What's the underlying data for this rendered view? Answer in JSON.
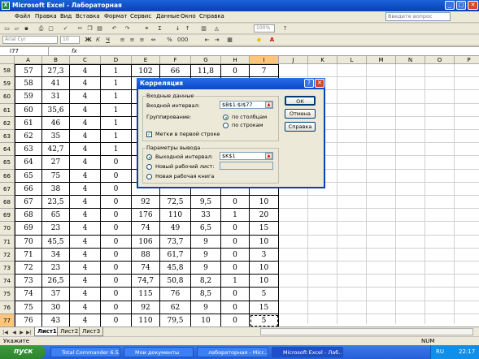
{
  "window": {
    "title": "Microsoft Excel - Лабораторная",
    "app_icon": "X"
  },
  "menu": [
    "Файл",
    "Правка",
    "Вид",
    "Вставка",
    "Формат",
    "Сервис",
    "Данные",
    "Окно",
    "Справка"
  ],
  "help_box": {
    "placeholder": "Введите вопрос"
  },
  "format_toolbar": {
    "font": "Arial Cyr",
    "size": "10",
    "zoom": "100%"
  },
  "formula_bar": {
    "cell": "I77",
    "fx": "fx"
  },
  "columns": [
    "A",
    "B",
    "C",
    "D",
    "E",
    "F",
    "G",
    "H",
    "I",
    "J",
    "K",
    "L",
    "M",
    "N",
    "O",
    "P"
  ],
  "rows": [
    {
      "n": "58",
      "v": [
        "57",
        "27,3",
        "4",
        "1",
        "102",
        "66",
        "11,8",
        "0",
        "7"
      ]
    },
    {
      "n": "59",
      "v": [
        "58",
        "41",
        "4",
        "1",
        "",
        "",
        "",
        "",
        ""
      ]
    },
    {
      "n": "60",
      "v": [
        "59",
        "31",
        "4",
        "1",
        "",
        "",
        "",
        "",
        ""
      ]
    },
    {
      "n": "61",
      "v": [
        "60",
        "35,6",
        "4",
        "1",
        "",
        "",
        "",
        "",
        ""
      ]
    },
    {
      "n": "62",
      "v": [
        "61",
        "46",
        "4",
        "1",
        "",
        "",
        "",
        "",
        ""
      ]
    },
    {
      "n": "63",
      "v": [
        "62",
        "35",
        "4",
        "1",
        "",
        "",
        "",
        "",
        ""
      ]
    },
    {
      "n": "64",
      "v": [
        "63",
        "42,7",
        "4",
        "1",
        "",
        "",
        "",
        "",
        ""
      ]
    },
    {
      "n": "65",
      "v": [
        "64",
        "27",
        "4",
        "0",
        "",
        "",
        "",
        "",
        ""
      ]
    },
    {
      "n": "66",
      "v": [
        "65",
        "75",
        "4",
        "0",
        "",
        "",
        "",
        "",
        ""
      ]
    },
    {
      "n": "67",
      "v": [
        "66",
        "38",
        "4",
        "0",
        "",
        "",
        "",
        "",
        ""
      ]
    },
    {
      "n": "68",
      "v": [
        "67",
        "23,5",
        "4",
        "0",
        "92",
        "72,5",
        "9,5",
        "0",
        "10"
      ]
    },
    {
      "n": "69",
      "v": [
        "68",
        "65",
        "4",
        "0",
        "176",
        "110",
        "33",
        "1",
        "20"
      ]
    },
    {
      "n": "70",
      "v": [
        "69",
        "23",
        "4",
        "0",
        "74",
        "49",
        "6,5",
        "0",
        "15"
      ]
    },
    {
      "n": "71",
      "v": [
        "70",
        "45,5",
        "4",
        "0",
        "106",
        "73,7",
        "9",
        "0",
        "10"
      ]
    },
    {
      "n": "72",
      "v": [
        "71",
        "34",
        "4",
        "0",
        "88",
        "61,7",
        "9",
        "0",
        "3"
      ]
    },
    {
      "n": "73",
      "v": [
        "72",
        "23",
        "4",
        "0",
        "74",
        "45,8",
        "9",
        "0",
        "10"
      ]
    },
    {
      "n": "74",
      "v": [
        "73",
        "26,5",
        "4",
        "0",
        "74,7",
        "50,8",
        "8,2",
        "1",
        "10"
      ]
    },
    {
      "n": "75",
      "v": [
        "74",
        "37",
        "4",
        "0",
        "115",
        "76",
        "8,5",
        "0",
        "5"
      ]
    },
    {
      "n": "76",
      "v": [
        "75",
        "30",
        "4",
        "0",
        "92",
        "62",
        "9",
        "0",
        "15"
      ]
    },
    {
      "n": "77",
      "v": [
        "76",
        "43",
        "4",
        "0",
        "110",
        "79,5",
        "10",
        "0",
        "5"
      ]
    }
  ],
  "sheet_tabs": [
    "Лист1",
    "Лист2",
    "Лист3"
  ],
  "status": {
    "left": "Укажите",
    "right": "NUM"
  },
  "taskbar": {
    "start": "пуск",
    "tasks": [
      "Total Commander 6.5...",
      "Мои документы",
      "лабораторная - Micr...",
      "Microsoft Excel - Лаб..."
    ],
    "lang": "RU",
    "clock": "22:17"
  },
  "dialog": {
    "title": "Корреляция",
    "input_group": "Входные данные",
    "input_range_label": "Входной интервал:",
    "input_range_value": "$B$1:$I$77",
    "grouping_label": "Группирование:",
    "by_columns": "по столбцам",
    "by_rows": "по строкам",
    "labels_first_row": "Метки в первой строке",
    "output_group": "Параметры вывода",
    "output_range_label": "Выходной интервал:",
    "output_range_value": "$K$1",
    "new_sheet": "Новый рабочий лист:",
    "new_book": "Новая рабочая книга",
    "ok": "ОК",
    "cancel": "Отмена",
    "help": "Справка"
  }
}
